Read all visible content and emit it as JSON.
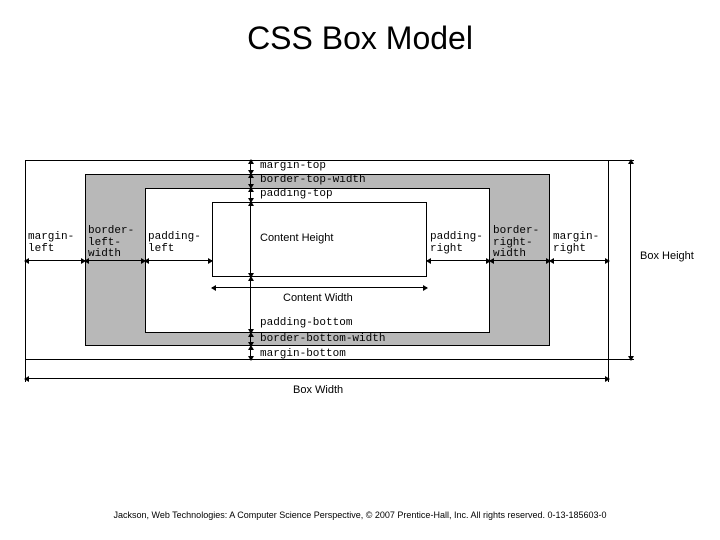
{
  "title": "CSS Box Model",
  "labels": {
    "margin_top": "margin-top",
    "border_top": "border-top-width",
    "padding_top": "padding-top",
    "content_height": "Content Height",
    "content_width": "Content Width",
    "padding_bottom": "padding-bottom",
    "border_bottom": "border-bottom-width",
    "margin_bottom": "margin-bottom",
    "margin_left": "margin-\nleft",
    "border_left": "border-\nleft-\nwidth",
    "padding_left": "padding-\nleft",
    "padding_right": "padding-\nright",
    "border_right": "border-\nright-\nwidth",
    "margin_right": "margin-\nright",
    "box_width": "Box Width",
    "box_height": "Box\nHeight"
  },
  "footer": "Jackson, Web Technologies: A Computer Science Perspective, © 2007 Prentice-Hall, Inc. All rights reserved. 0-13-185603-0"
}
